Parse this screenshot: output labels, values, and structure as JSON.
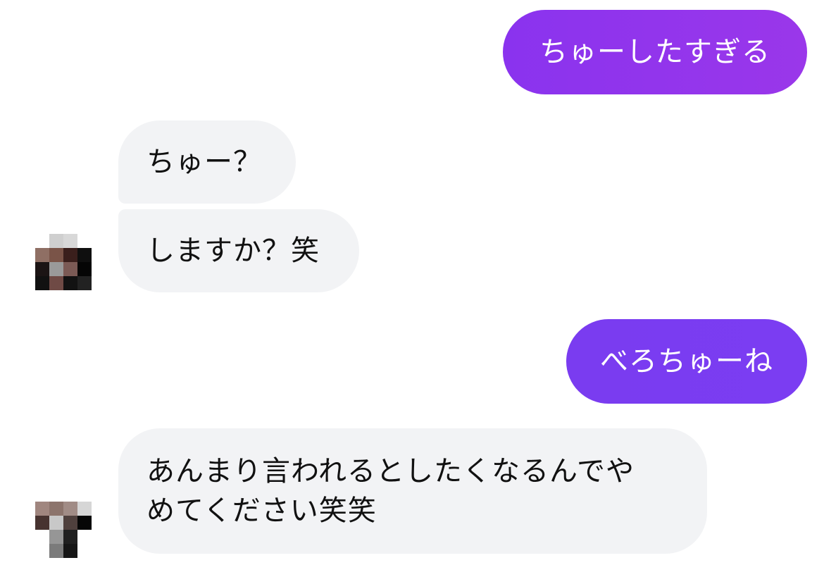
{
  "conversation": {
    "messages": [
      {
        "from": "me",
        "text": "ちゅーしたすぎる"
      },
      {
        "from": "them",
        "text": "ちゅー？"
      },
      {
        "from": "them",
        "text": "しますか？笑"
      },
      {
        "from": "me",
        "text": "べろちゅーね"
      },
      {
        "from": "them",
        "lines": [
          "あんまり言われるとしたくなるんでや",
          "めてください笑笑"
        ]
      }
    ]
  },
  "colors": {
    "outgoing_bubble": "#8a35ee",
    "incoming_bubble": "#f2f3f5",
    "incoming_text": "#111111",
    "outgoing_text": "#ffffff"
  },
  "avatars": {
    "contact_avatar": "pixelated-avatar"
  }
}
